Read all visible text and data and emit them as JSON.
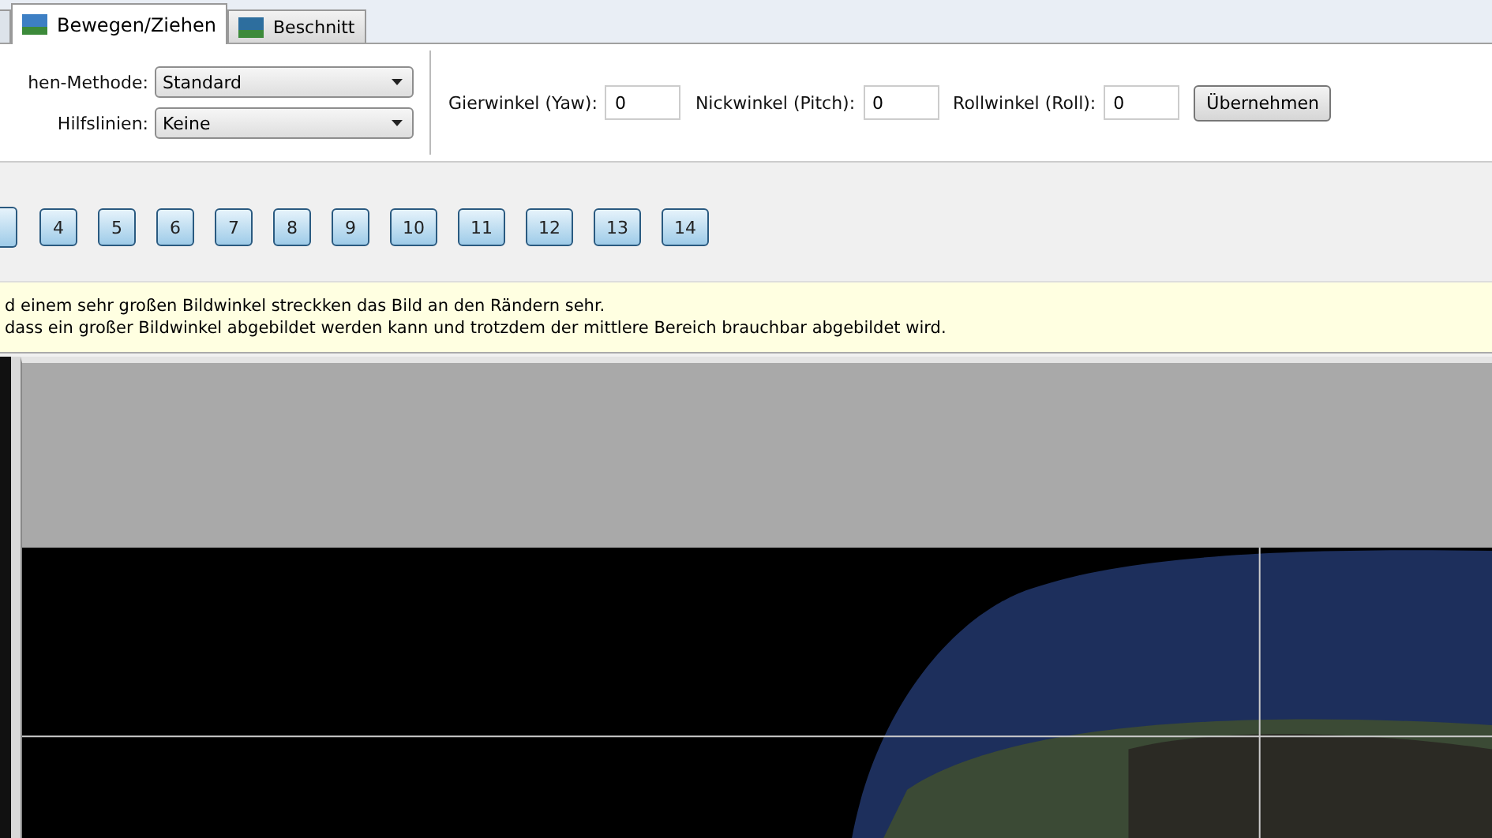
{
  "tabs": [
    {
      "label": "Bewegen/Ziehen",
      "selected": true
    },
    {
      "label": "Beschnitt",
      "selected": false
    }
  ],
  "settings": [
    {
      "label": "hen-Methode:",
      "value": "Standard"
    },
    {
      "label": "Hilfslinien:",
      "value": "Keine"
    }
  ],
  "angles": [
    {
      "label": "Gierwinkel (Yaw):",
      "value": "0"
    },
    {
      "label": "Nickwinkel (Pitch):",
      "value": "0"
    },
    {
      "label": "Rollwinkel (Roll):",
      "value": "0"
    }
  ],
  "apply_button": "Übernehmen",
  "image_buttons": [
    "4",
    "5",
    "6",
    "7",
    "8",
    "9",
    "10",
    "11",
    "12",
    "13",
    "14"
  ],
  "info_lines": [
    "d einem sehr großen Bildwinkel streckken das Bild an den Rändern sehr.",
    "dass ein großer Bildwinkel abgebildet werden kann und trotzdem der mittlere Bereich brauchbar abgebildet wird."
  ]
}
